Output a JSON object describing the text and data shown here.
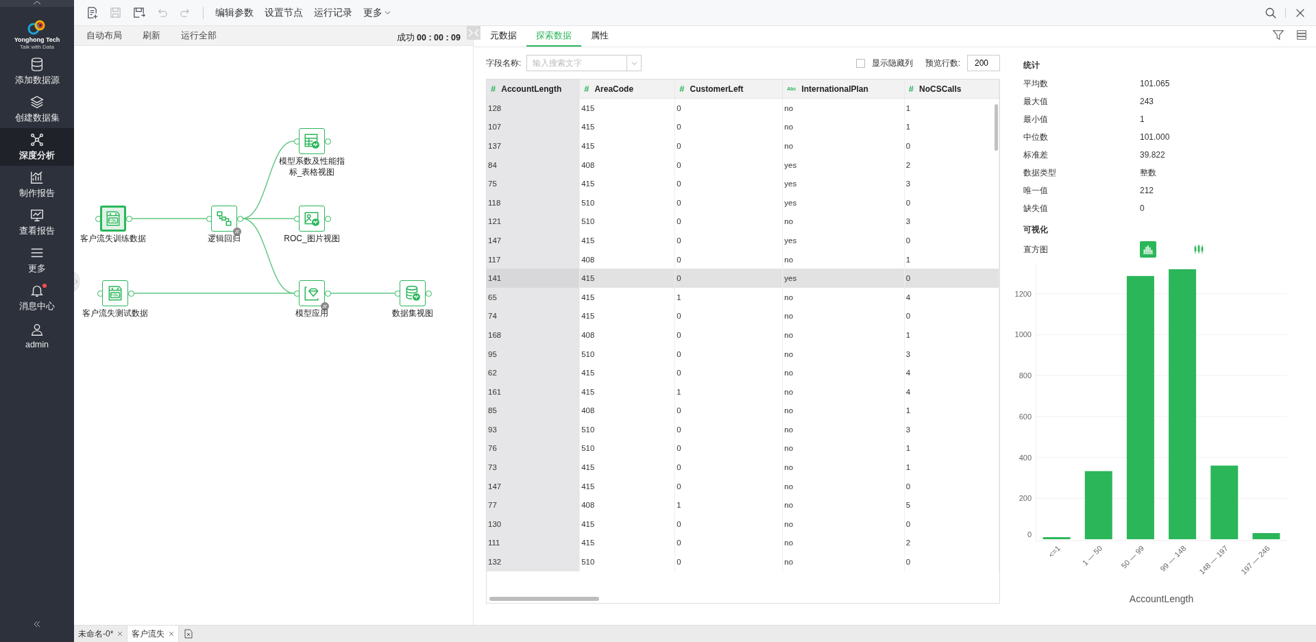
{
  "sidebar": {
    "logo": {
      "name": "Yonghong Tech",
      "tagline": "Talk with Data"
    },
    "items": [
      {
        "label": "添加数据源",
        "kind": "database",
        "selected": false,
        "badge": false
      },
      {
        "label": "创建数据集",
        "kind": "layers",
        "selected": false,
        "badge": false
      },
      {
        "label": "深度分析",
        "kind": "network",
        "selected": true,
        "badge": false
      },
      {
        "label": "制作报告",
        "kind": "chart",
        "selected": false,
        "badge": false
      },
      {
        "label": "查看报告",
        "kind": "monitor",
        "selected": false,
        "badge": false
      },
      {
        "label": "更多",
        "kind": "menu",
        "selected": false,
        "badge": false
      },
      {
        "label": "消息中心",
        "kind": "bell",
        "selected": false,
        "badge": true
      },
      {
        "label": "admin",
        "kind": "user",
        "selected": false,
        "badge": false
      }
    ]
  },
  "toolbar": {
    "tools": [
      {
        "kind": "new",
        "disabled": false
      },
      {
        "kind": "save",
        "disabled": true
      },
      {
        "kind": "save-as",
        "disabled": false
      },
      {
        "kind": "undo",
        "disabled": true
      },
      {
        "kind": "redo",
        "disabled": true
      }
    ],
    "menus": [
      {
        "label": "编辑参数",
        "dropdown": false
      },
      {
        "label": "设置节点",
        "dropdown": false
      },
      {
        "label": "运行记录",
        "dropdown": false
      },
      {
        "label": "更多",
        "dropdown": true
      }
    ]
  },
  "canvas_toolbar": {
    "actions": [
      "自动布局",
      "刷新",
      "运行全部"
    ],
    "status": "成功",
    "time": "00 : 00 : 09"
  },
  "flow": {
    "nodes": [
      {
        "label": "客户流失训练数据",
        "kind": "sql",
        "selected": true,
        "badge": false
      },
      {
        "label": "客户流失测试数据",
        "kind": "sql",
        "selected": false,
        "badge": false
      },
      {
        "label": "逻辑回归",
        "kind": "regression",
        "selected": false,
        "badge": true
      },
      {
        "label": "模型系数及性能指标_表格视图",
        "kind": "table-view",
        "selected": false,
        "badge": false
      },
      {
        "label": "ROC_图片视图",
        "kind": "image-view",
        "selected": false,
        "badge": false
      },
      {
        "label": "模型应用",
        "kind": "model-apply",
        "selected": false,
        "badge": true
      },
      {
        "label": "数据集视图",
        "kind": "dataset-view",
        "selected": false,
        "badge": false
      }
    ]
  },
  "detail": {
    "tabs": [
      {
        "label": "元数据",
        "selected": false
      },
      {
        "label": "探索数据",
        "selected": true
      },
      {
        "label": "属性",
        "selected": false
      }
    ],
    "field_label": "字段名称:",
    "search_placeholder": "输入搜索文字",
    "show_hidden": {
      "label": "显示隐藏列",
      "checked": false
    },
    "preview_label": "预览行数:",
    "preview_value": "200",
    "table": {
      "columns": [
        {
          "name": "AccountLength",
          "type_mark": "#",
          "selected": true
        },
        {
          "name": "AreaCode",
          "type_mark": "#",
          "selected": false
        },
        {
          "name": "CustomerLeft",
          "type_mark": "#",
          "selected": false
        },
        {
          "name": "InternationalPlan",
          "type_mark": "Abc",
          "selected": false
        },
        {
          "name": "NoCSCalls",
          "type_mark": "#",
          "selected": false
        }
      ],
      "rows": [
        {
          "cells": [
            "128",
            "415",
            "0",
            "no",
            "1"
          ],
          "selected": false
        },
        {
          "cells": [
            "107",
            "415",
            "0",
            "no",
            "1"
          ],
          "selected": false
        },
        {
          "cells": [
            "137",
            "415",
            "0",
            "no",
            "0"
          ],
          "selected": false
        },
        {
          "cells": [
            "84",
            "408",
            "0",
            "yes",
            "2"
          ],
          "selected": false
        },
        {
          "cells": [
            "75",
            "415",
            "0",
            "yes",
            "3"
          ],
          "selected": false
        },
        {
          "cells": [
            "118",
            "510",
            "0",
            "yes",
            "0"
          ],
          "selected": false
        },
        {
          "cells": [
            "121",
            "510",
            "0",
            "no",
            "3"
          ],
          "selected": false
        },
        {
          "cells": [
            "147",
            "415",
            "0",
            "yes",
            "0"
          ],
          "selected": false
        },
        {
          "cells": [
            "117",
            "408",
            "0",
            "no",
            "1"
          ],
          "selected": false
        },
        {
          "cells": [
            "141",
            "415",
            "0",
            "yes",
            "0"
          ],
          "selected": true
        },
        {
          "cells": [
            "65",
            "415",
            "1",
            "no",
            "4"
          ],
          "selected": false
        },
        {
          "cells": [
            "74",
            "415",
            "0",
            "no",
            "0"
          ],
          "selected": false
        },
        {
          "cells": [
            "168",
            "408",
            "0",
            "no",
            "1"
          ],
          "selected": false
        },
        {
          "cells": [
            "95",
            "510",
            "0",
            "no",
            "3"
          ],
          "selected": false
        },
        {
          "cells": [
            "62",
            "415",
            "0",
            "no",
            "4"
          ],
          "selected": false
        },
        {
          "cells": [
            "161",
            "415",
            "1",
            "no",
            "4"
          ],
          "selected": false
        },
        {
          "cells": [
            "85",
            "408",
            "0",
            "no",
            "1"
          ],
          "selected": false
        },
        {
          "cells": [
            "93",
            "510",
            "0",
            "no",
            "3"
          ],
          "selected": false
        },
        {
          "cells": [
            "76",
            "510",
            "0",
            "no",
            "1"
          ],
          "selected": false
        },
        {
          "cells": [
            "73",
            "415",
            "0",
            "no",
            "1"
          ],
          "selected": false
        },
        {
          "cells": [
            "147",
            "415",
            "0",
            "no",
            "0"
          ],
          "selected": false
        },
        {
          "cells": [
            "77",
            "408",
            "1",
            "no",
            "5"
          ],
          "selected": false
        },
        {
          "cells": [
            "130",
            "415",
            "0",
            "no",
            "0"
          ],
          "selected": false
        },
        {
          "cells": [
            "111",
            "415",
            "0",
            "no",
            "2"
          ],
          "selected": false
        },
        {
          "cells": [
            "132",
            "510",
            "0",
            "no",
            "0"
          ],
          "selected": false
        }
      ]
    }
  },
  "stats": {
    "title": "统计",
    "rows": [
      {
        "label": "平均数",
        "value": "101.065"
      },
      {
        "label": "最大值",
        "value": "243"
      },
      {
        "label": "最小值",
        "value": "1"
      },
      {
        "label": "中位数",
        "value": "101.000"
      },
      {
        "label": "标准差",
        "value": "39.822"
      },
      {
        "label": "数据类型",
        "value": "整数"
      },
      {
        "label": "唯一值",
        "value": "212"
      },
      {
        "label": "缺失值",
        "value": "0"
      }
    ]
  },
  "visual": {
    "title": "可视化",
    "label": "直方图",
    "views": [
      {
        "kind": "histogram",
        "selected": true
      },
      {
        "kind": "boxplot",
        "selected": false
      }
    ],
    "chart_data": {
      "type": "bar",
      "xlabel": "AccountLength",
      "categories": [
        "<=1",
        "1 — 50",
        "50 — 99",
        "99 — 148",
        "148 — 197",
        "197 — 246"
      ],
      "series": [
        {
          "color": "#2bb65a",
          "values": [
            10,
            333,
            1287,
            1320,
            360,
            30
          ]
        }
      ],
      "grid": true,
      "ylim": [
        0,
        1350
      ],
      "yticks": [
        0,
        200,
        400,
        600,
        800,
        1000,
        1200
      ]
    }
  },
  "bottom_tabs": [
    {
      "label": "未命名-0*",
      "selected": false
    },
    {
      "label": "客户流失",
      "selected": true
    }
  ]
}
